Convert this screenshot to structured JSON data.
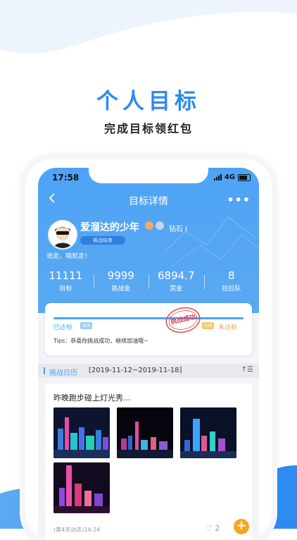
{
  "promo": {
    "title": "个人目标",
    "subtitle": "完成目标领红包"
  },
  "status_bar": {
    "time": "17:58",
    "network": "4G"
  },
  "nav": {
    "title": "目标详情",
    "more": "•••"
  },
  "profile": {
    "username": "爱溜达的少年",
    "level": "钻石 I",
    "status_pill": "挑战结束",
    "motto": "说走，咱就走！"
  },
  "stats": [
    {
      "value": "11111",
      "label": "目标"
    },
    {
      "value": "9999",
      "label": "挑战金"
    },
    {
      "value": "6894.7",
      "label": "赏金"
    },
    {
      "value": "8",
      "label": "拉拉队"
    }
  ],
  "challenge_card": {
    "done_label": "已达标",
    "done_count": "4/4",
    "miss_count": "0/8",
    "miss_label": "未达标",
    "stamp": "挑战成功",
    "tips": "Tips：恭喜你挑战成功，继续加油哦~",
    "progress": 1.0
  },
  "calendar": {
    "title": "挑战日历",
    "range": "[2019-11-12~2019-11-18]",
    "sort_icon": "↑☰"
  },
  "post": {
    "text": "昨晚跑步碰上灯光秀...",
    "meta": "(第4天动态)14:24",
    "like_count": "2",
    "fab": "+"
  },
  "colors": {
    "brand_blue": "#4ea3f5",
    "title_blue": "#2e8bef",
    "warn_orange": "#f2a43b",
    "stamp_red": "#d94c55"
  }
}
